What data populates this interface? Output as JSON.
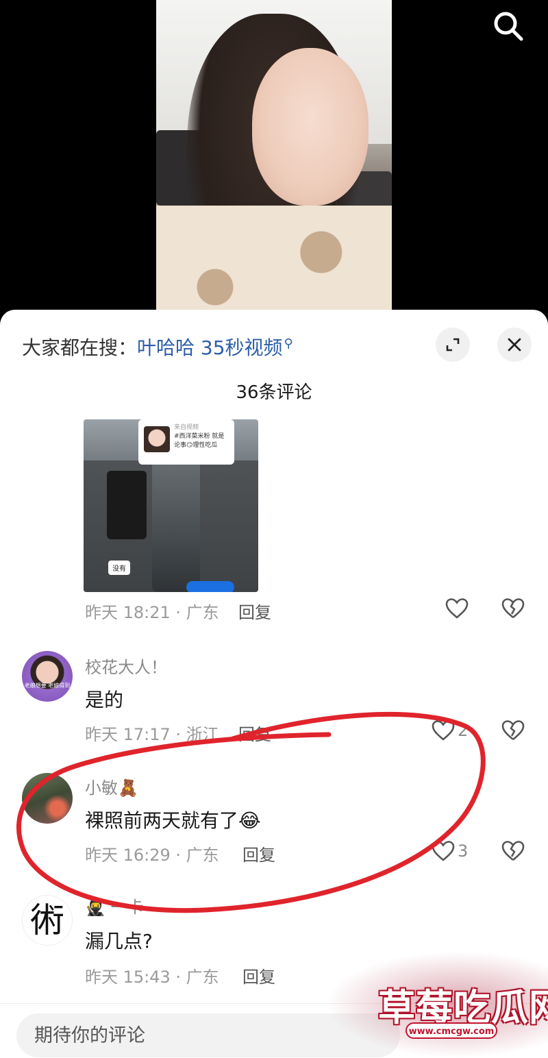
{
  "header": {
    "search_icon": "search-icon"
  },
  "sheet": {
    "hot_search_prefix": "大家都在搜：",
    "hot_search_term": "叶哈哈 35秒视频",
    "hot_search_icon": "search-small-icon",
    "expand_icon": "expand-icon",
    "close_icon": "close-icon",
    "count_title": "36条评论"
  },
  "image_comment": {
    "card_source": "来自视频",
    "card_text": "#西洋菜米粉 就是论事😏理性吃瓜",
    "chip_text": "没有",
    "time_loc": "昨天 18:21 · 广东",
    "reply": "回复"
  },
  "comments": [
    {
      "user": "校花大人！",
      "avatar_text": "老娘想要 老娘得到",
      "text": "是的",
      "time_loc": "昨天 17:17 · 浙江",
      "reply": "回复",
      "likes": "2"
    },
    {
      "user": "小敏🧸",
      "text": "裸照前两天就有了😂",
      "time_loc": "昨天 16:29 · 广东",
      "reply": "回复",
      "likes": "3"
    },
    {
      "user": "🥷 一卡",
      "avatar_glyph": "術",
      "text": "漏几点?",
      "time_loc": "昨天 15:43 · 广东",
      "reply": "回复"
    }
  ],
  "input": {
    "placeholder": "期待你的评论"
  },
  "watermark": {
    "title": "草莓吃瓜网",
    "url": "www.cmcgw.com"
  },
  "colors": {
    "link": "#2b5da8",
    "annotation": "#e0242c",
    "meta": "#9a9a9a"
  }
}
